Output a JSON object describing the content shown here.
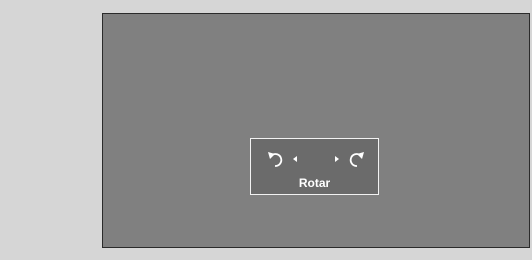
{
  "rotate_panel": {
    "label": "Rotar",
    "left_button_icon": "rotate-counterclockwise-icon",
    "right_button_icon": "rotate-clockwise-icon"
  },
  "colors": {
    "page_background": "#d6d6d6",
    "canvas_background": "#808080",
    "panel_background": "#6b6b6b",
    "panel_border": "#f2f2f2",
    "text": "#ffffff"
  }
}
